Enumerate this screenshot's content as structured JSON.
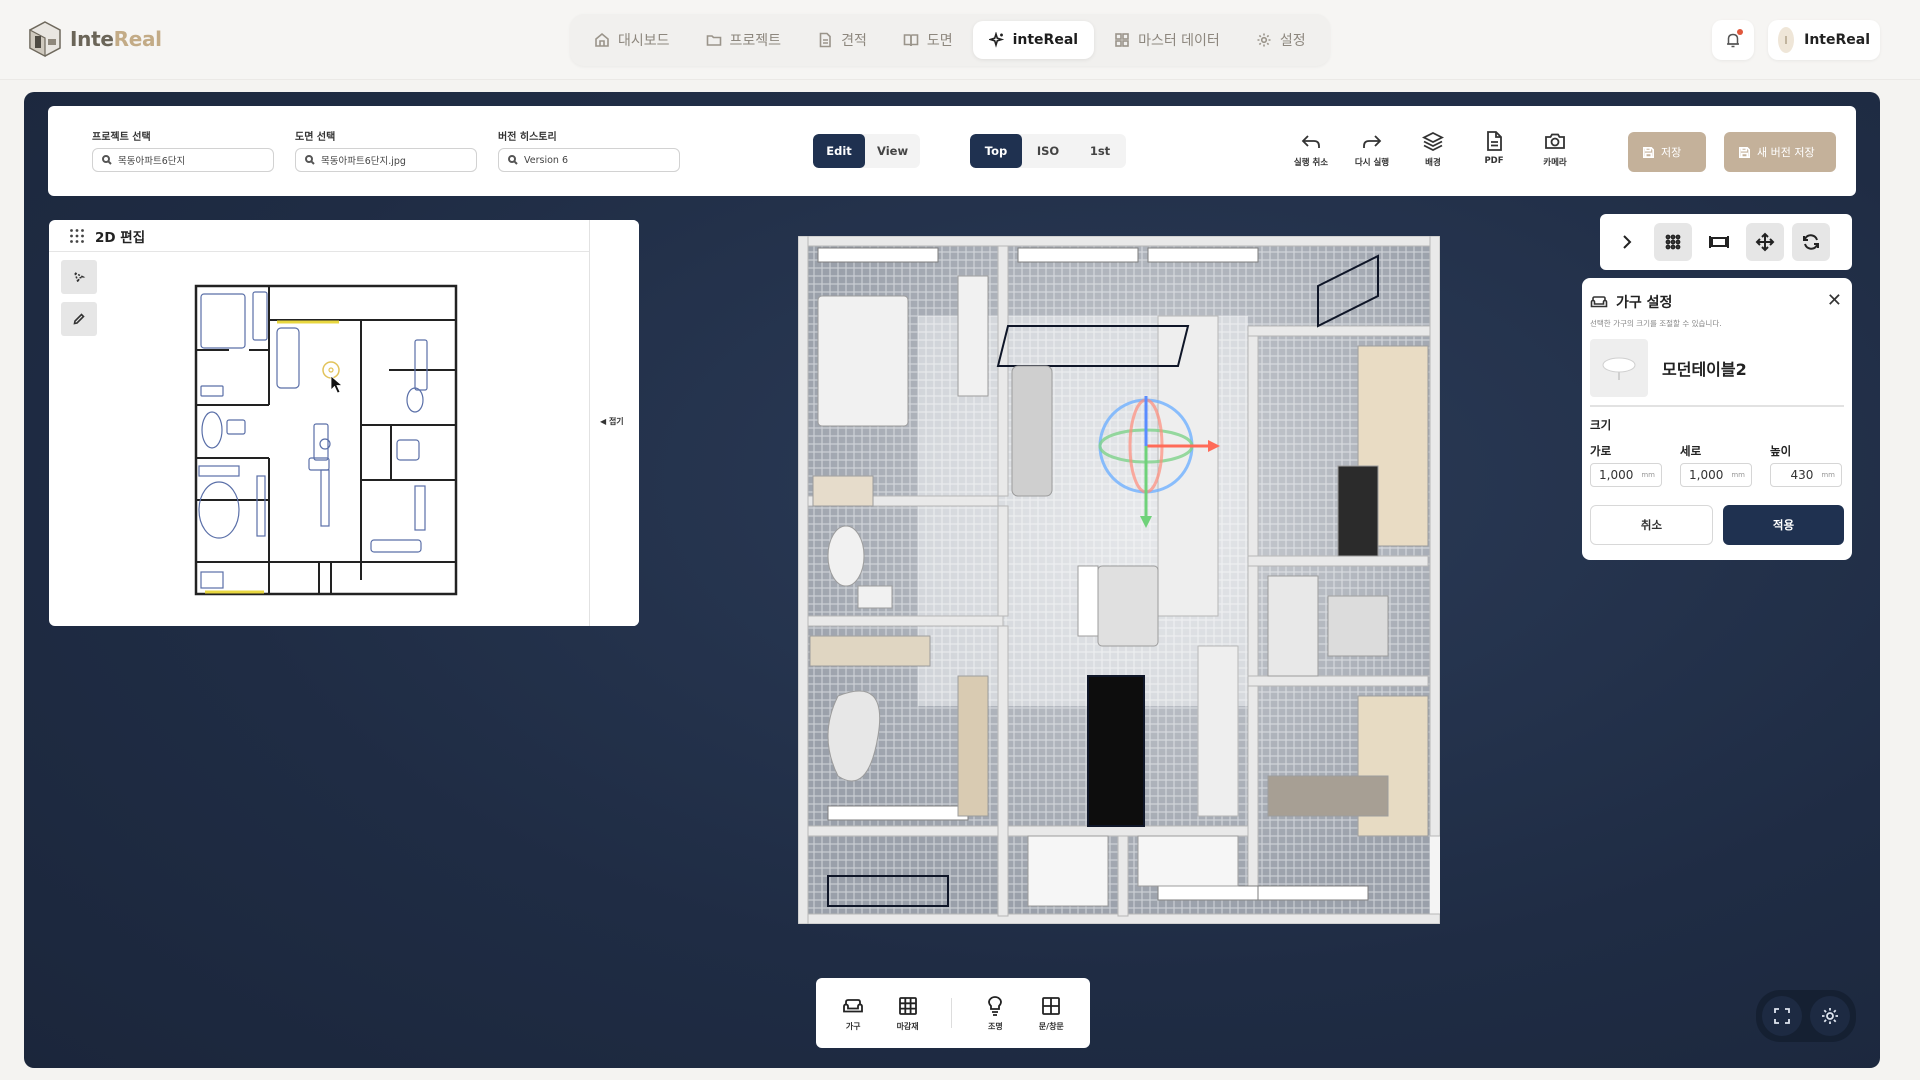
{
  "app": {
    "logo_text_a": "Inte",
    "logo_text_b": "Real"
  },
  "nav": {
    "items": [
      {
        "label": "대시보드",
        "icon": "home-icon"
      },
      {
        "label": "프로젝트",
        "icon": "folder-icon"
      },
      {
        "label": "견적",
        "icon": "document-icon"
      },
      {
        "label": "도면",
        "icon": "book-icon"
      },
      {
        "label": "inteReal",
        "icon": "sparkle-icon",
        "active": true
      },
      {
        "label": "마스터 데이터",
        "icon": "grid-icon"
      },
      {
        "label": "설정",
        "icon": "gear-icon"
      }
    ]
  },
  "user": {
    "initial": "I",
    "name": "InteReal"
  },
  "toolbar": {
    "project_label": "프로젝트 선택",
    "project_value": "목동아파트6단지",
    "drawing_label": "도면 선택",
    "drawing_value": "목동아파트6단지.jpg",
    "version_label": "버전 히스토리",
    "version_value": "Version 6",
    "mode": {
      "edit": "Edit",
      "view": "View",
      "selected": "Edit"
    },
    "camera": {
      "top": "Top",
      "iso": "ISO",
      "first": "1st",
      "selected": "Top"
    },
    "tools": [
      {
        "label": "실행 취소",
        "icon": "undo-icon"
      },
      {
        "label": "다시 실행",
        "icon": "redo-icon"
      },
      {
        "label": "배경",
        "icon": "layers-icon"
      },
      {
        "label": "PDF",
        "icon": "pdf-icon"
      },
      {
        "label": "카메라",
        "icon": "camera-icon"
      }
    ],
    "save": "저장",
    "save_new": "새 버전 저장"
  },
  "panel2d": {
    "title": "2D 편집",
    "collapse": "◀ 접기"
  },
  "furniture": {
    "title": "가구 설정",
    "subtitle": "선택한 가구의 크기를 조절할 수 있습니다.",
    "name": "모던테이블2",
    "size_label": "크기",
    "width_label": "가로",
    "width_value": "1,000",
    "depth_label": "세로",
    "depth_value": "1,000",
    "height_label": "높이",
    "height_value": "430",
    "unit": "mm",
    "cancel": "취소",
    "apply": "적용"
  },
  "dock": [
    {
      "label": "가구",
      "icon": "sofa-icon"
    },
    {
      "label": "마감재",
      "icon": "tile-icon"
    },
    {
      "label": "조명",
      "icon": "lamp-icon"
    },
    {
      "label": "문/창문",
      "icon": "window-icon"
    }
  ],
  "colors": {
    "navy": "#1f3150",
    "tan": "#c4b19a",
    "canvas": "#22304a"
  }
}
